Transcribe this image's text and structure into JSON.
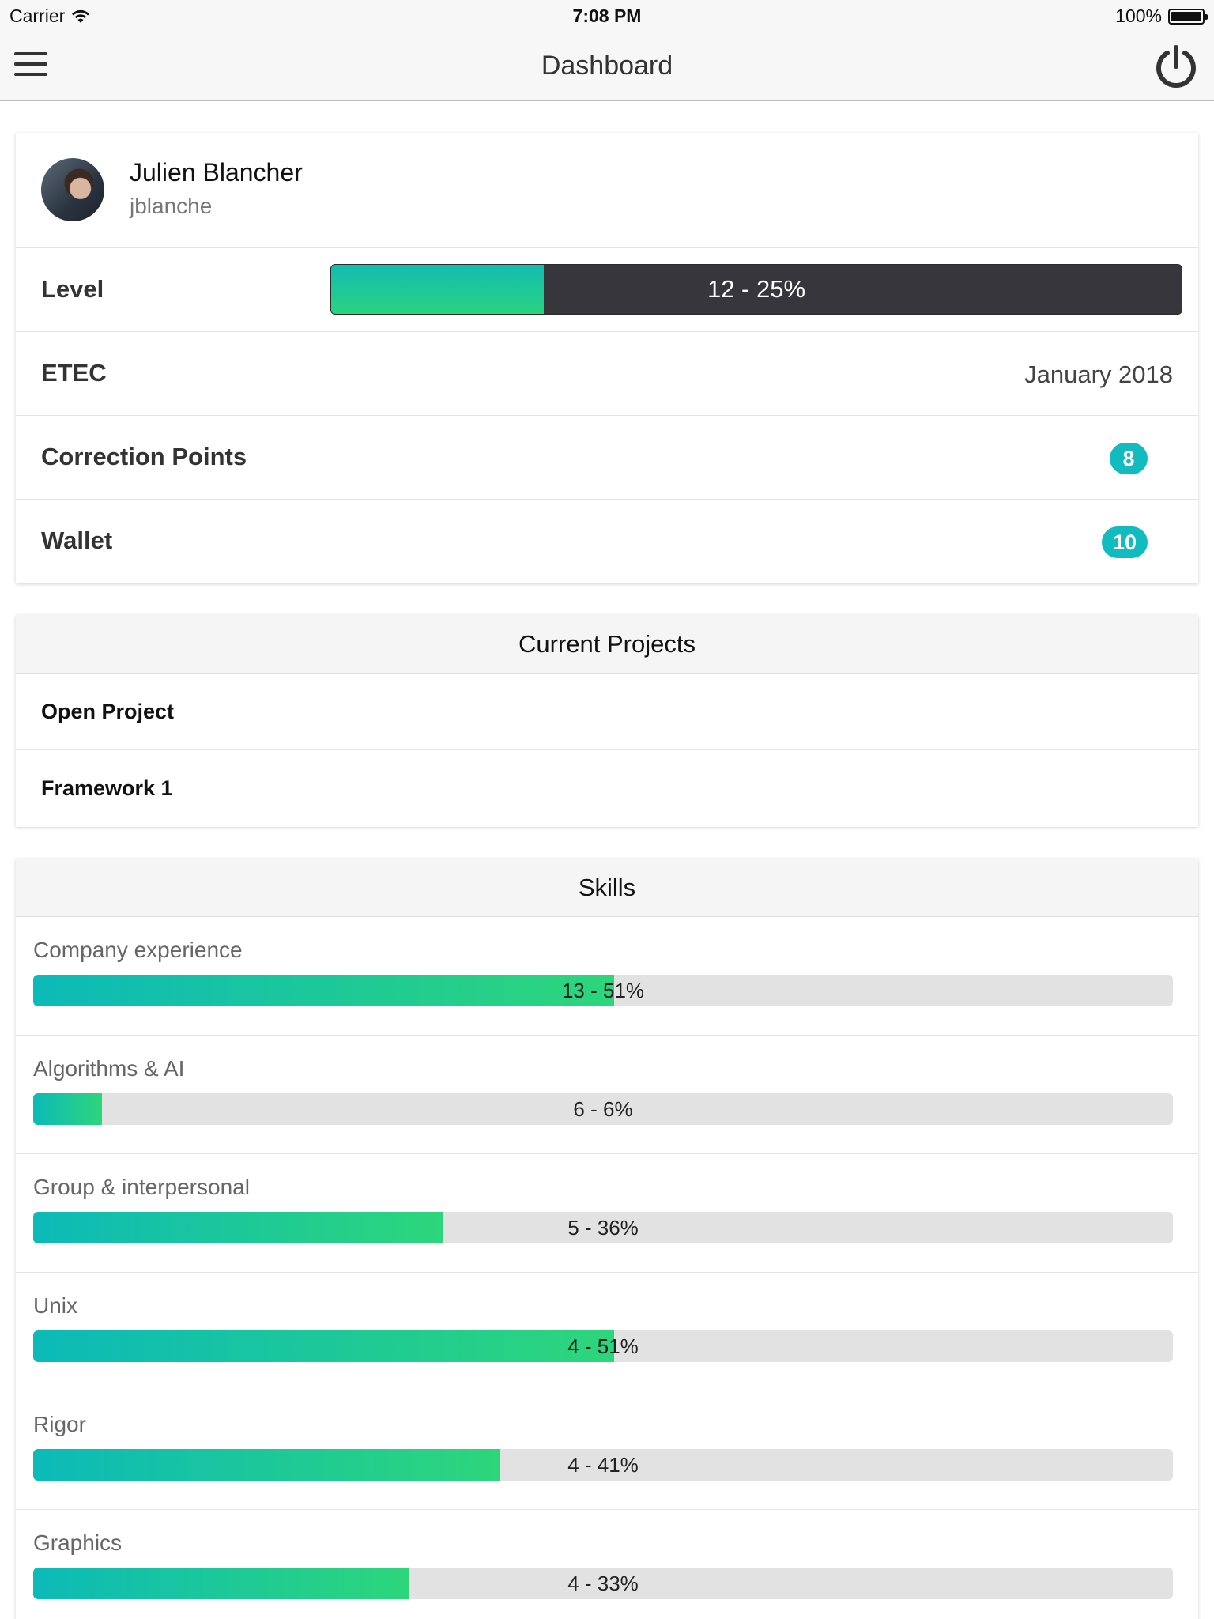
{
  "status_bar": {
    "carrier": "Carrier",
    "time": "7:08 PM",
    "battery": "100%"
  },
  "nav": {
    "title": "Dashboard"
  },
  "profile": {
    "name": "Julien Blancher",
    "login": "jblanche",
    "level_label": "Level",
    "level_text": "12 - 25%",
    "level_progress": 0.25,
    "etec_label": "ETEC",
    "etec_value": "January 2018",
    "correction_label": "Correction Points",
    "correction_value": "8",
    "wallet_label": "Wallet",
    "wallet_value": "10"
  },
  "projects": {
    "title": "Current Projects",
    "items": [
      {
        "label": "Open Project"
      },
      {
        "label": "Framework 1"
      }
    ]
  },
  "skills": {
    "title": "Skills",
    "items": [
      {
        "name": "Company experience",
        "text": "13 - 51%",
        "progress": 0.51
      },
      {
        "name": "Algorithms & AI",
        "text": "6 - 6%",
        "progress": 0.06
      },
      {
        "name": "Group & interpersonal",
        "text": "5 - 36%",
        "progress": 0.36
      },
      {
        "name": "Unix",
        "text": "4 - 51%",
        "progress": 0.51
      },
      {
        "name": "Rigor",
        "text": "4 - 41%",
        "progress": 0.41
      },
      {
        "name": "Graphics",
        "text": "4 - 33%",
        "progress": 0.33
      }
    ]
  },
  "colors": {
    "accent": "#12bbbd",
    "progress_start": "#0cbab8",
    "progress_end": "#2dd67a",
    "level_track": "#36363c"
  }
}
